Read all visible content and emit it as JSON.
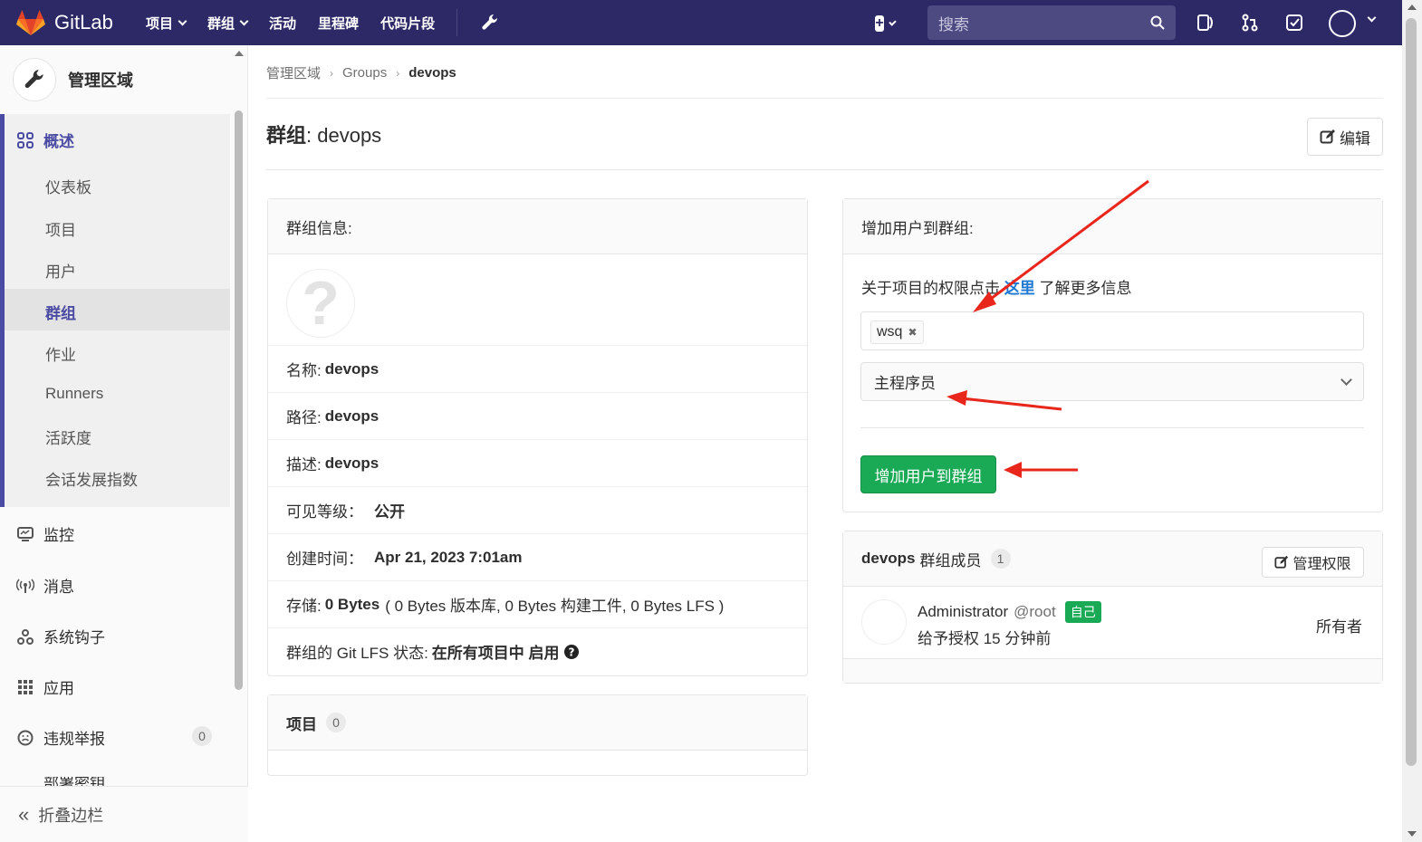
{
  "navbar": {
    "brand": "GitLab",
    "items": [
      "项目",
      "群组",
      "活动",
      "里程碑",
      "代码片段"
    ],
    "search_placeholder": "搜索"
  },
  "sidebar": {
    "title": "管理区域",
    "overview_label": "概述",
    "sub_items": [
      "仪表板",
      "项目",
      "用户",
      "群组",
      "作业",
      "Runners",
      "活跃度",
      "会话发展指数"
    ],
    "active_sub": "群组",
    "sections": [
      {
        "label": "监控",
        "icon": "monitor-icon"
      },
      {
        "label": "消息",
        "icon": "broadcast-icon"
      },
      {
        "label": "系统钩子",
        "icon": "hook-icon"
      },
      {
        "label": "应用",
        "icon": "apps-icon"
      },
      {
        "label": "违规举报",
        "icon": "abuse-icon",
        "count": "0"
      },
      {
        "label": "部署密钥",
        "icon": "key-icon"
      }
    ],
    "collapse_label": "折叠边栏"
  },
  "breadcrumb": [
    "管理区域",
    "Groups",
    "devops"
  ],
  "page": {
    "title_prefix": "群组",
    "title_name": ": devops",
    "edit_label": "编辑"
  },
  "group_info": {
    "header": "群组信息:",
    "rows": [
      {
        "label": "名称:",
        "value": "devops"
      },
      {
        "label": "路径:",
        "value": "devops"
      },
      {
        "label": "描述:",
        "value": "devops"
      },
      {
        "label": "可见等级：",
        "value": "公开"
      },
      {
        "label": "创建时间：",
        "value": "Apr 21, 2023 7:01am"
      }
    ],
    "storage_label": "存储:",
    "storage_value": "0 Bytes",
    "storage_detail": "( 0 Bytes 版本库, 0 Bytes 构建工件, 0 Bytes LFS )",
    "lfs_label": "群组的 Git LFS 状态:",
    "lfs_value": "在所有项目中 启用"
  },
  "projects": {
    "header": "项目",
    "count": "0"
  },
  "add_user": {
    "header": "增加用户到群组:",
    "help_before": "关于项目的权限点击",
    "help_link": "这里",
    "help_after": "了解更多信息",
    "token": "wsq",
    "role": "主程序员",
    "button": "增加用户到群组"
  },
  "members": {
    "group_name": "devops",
    "header_suffix": "群组成员",
    "count": "1",
    "manage_label": "管理权限",
    "list": [
      {
        "name": "Administrator",
        "username": "@root",
        "badge": "自己",
        "granted": "给予授权 15 分钟前",
        "role": "所有者"
      }
    ]
  },
  "colors": {
    "navbar": "#2c2966",
    "accent": "#4b4ba3",
    "success": "#1aaa55",
    "link": "#1f78d1",
    "annotation": "#e8261c"
  }
}
